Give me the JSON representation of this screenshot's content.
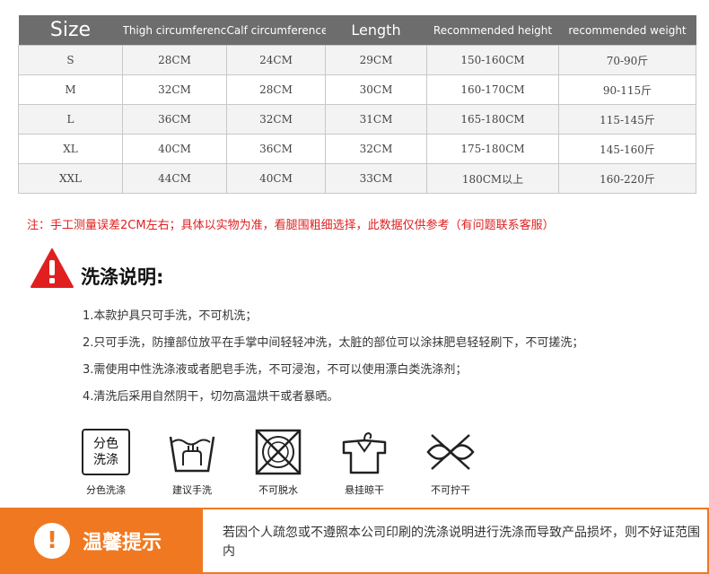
{
  "size_table": {
    "headers": [
      "Size",
      "Thigh circumference",
      "Calf circumference",
      "Length",
      "Recommended height",
      "recommended weight"
    ],
    "rows": [
      [
        "S",
        "28CM",
        "24CM",
        "29CM",
        "150-160CM",
        "70-90斤"
      ],
      [
        "M",
        "32CM",
        "28CM",
        "30CM",
        "160-170CM",
        "90-115斤"
      ],
      [
        "L",
        "36CM",
        "32CM",
        "31CM",
        "165-180CM",
        "115-145斤"
      ],
      [
        "XL",
        "40CM",
        "36CM",
        "32CM",
        "175-180CM",
        "145-160斤"
      ],
      [
        "XXL",
        "44CM",
        "40CM",
        "33CM",
        "180CM以上",
        "160-220斤"
      ]
    ]
  },
  "note": "注：手工测量误差2CM左右；具体以实物为准，看腿围粗细选择，此数据仅供参考（有问题联系客服）",
  "wash": {
    "title": "洗涤说明:",
    "instructions": [
      "1.本款护具只可手洗，不可机洗；",
      "2.只可手洗，防撞部位放平在手掌中间轻轻冲洗，太脏的部位可以涂抹肥皂轻轻刷下，不可搓洗；",
      "3.需使用中性洗涤液或者肥皂手洗，不可浸泡，不可以使用漂白类洗涤剂；",
      "4.清洗后采用自然阴干，切勿高温烘干或者暴晒。"
    ]
  },
  "care_icons": [
    {
      "icon": "separate-wash-icon",
      "label": "分色洗涤",
      "box_line1": "分色",
      "box_line2": "洗涤"
    },
    {
      "icon": "hand-wash-icon",
      "label": "建议手洗"
    },
    {
      "icon": "no-spin-dry-icon",
      "label": "不可脱水"
    },
    {
      "icon": "hang-dry-icon",
      "label": "悬挂晾干"
    },
    {
      "icon": "no-wring-icon",
      "label": "不可拧干"
    }
  ],
  "tips": {
    "title": "温馨提示",
    "icon": "exclamation-icon",
    "text": "若因个人疏忽或不遵照本公司印刷的洗涤说明进行洗涤而导致产品损坏，则不好证范围内"
  },
  "colors": {
    "header_bg": "#6d6d6d",
    "note_red": "#e02020",
    "warning_red": "#e02020",
    "tips_orange": "#f07820"
  }
}
